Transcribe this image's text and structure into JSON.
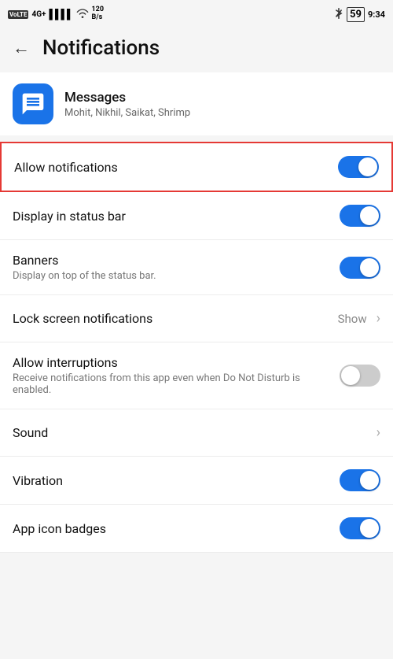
{
  "statusBar": {
    "left": {
      "volte": "VoLTE",
      "signal": "4G+",
      "bars": "||||",
      "wifi": "WiFi",
      "speed": "120",
      "speedUnit": "B/s"
    },
    "right": {
      "bluetooth": "BT",
      "battery": "59",
      "time": "9:34"
    }
  },
  "header": {
    "backLabel": "←",
    "title": "Notifications"
  },
  "appInfo": {
    "name": "Messages",
    "contacts": "Mohit, Nikhil, Saikat, Shrimp"
  },
  "settings": [
    {
      "id": "allow-notifications",
      "title": "Allow notifications",
      "subtitle": null,
      "control": "toggle",
      "toggleOn": true,
      "highlighted": true
    },
    {
      "id": "display-status-bar",
      "title": "Display in status bar",
      "subtitle": null,
      "control": "toggle",
      "toggleOn": true,
      "highlighted": false
    },
    {
      "id": "banners",
      "title": "Banners",
      "subtitle": "Display on top of the status bar.",
      "control": "toggle",
      "toggleOn": true,
      "highlighted": false
    },
    {
      "id": "lock-screen",
      "title": "Lock screen notifications",
      "subtitle": null,
      "control": "chevron",
      "value": "Show",
      "highlighted": false
    },
    {
      "id": "allow-interruptions",
      "title": "Allow interruptions",
      "subtitle": "Receive notifications from this app even when Do Not Disturb is enabled.",
      "control": "toggle",
      "toggleOn": false,
      "highlighted": false
    },
    {
      "id": "sound",
      "title": "Sound",
      "subtitle": null,
      "control": "chevron",
      "value": null,
      "highlighted": false
    },
    {
      "id": "vibration",
      "title": "Vibration",
      "subtitle": null,
      "control": "toggle",
      "toggleOn": true,
      "highlighted": false
    },
    {
      "id": "app-icon-badges",
      "title": "App icon badges",
      "subtitle": null,
      "control": "toggle",
      "toggleOn": true,
      "highlighted": false
    }
  ]
}
